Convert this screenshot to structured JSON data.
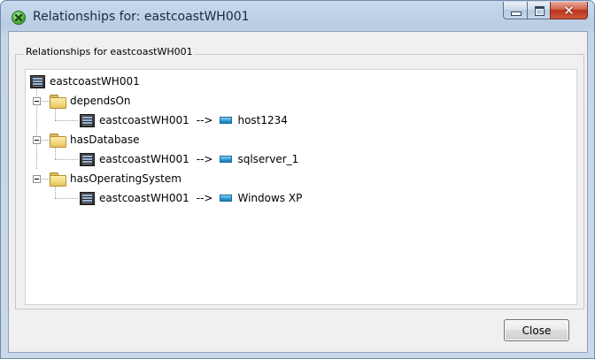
{
  "window": {
    "title": "Relationships for:  eastcoastWH001"
  },
  "group": {
    "legend": "Relationships for eastcoastWH001"
  },
  "tree": {
    "root": {
      "label": "eastcoastWH001",
      "icon": "server-icon"
    },
    "relations": [
      {
        "name": "dependsOn",
        "icon": "folder-icon",
        "child": {
          "source": "eastcoastWH001",
          "arrow": "-->",
          "target": "host1234",
          "target_icon": "host-icon"
        }
      },
      {
        "name": "hasDatabase",
        "icon": "folder-icon",
        "child": {
          "source": "eastcoastWH001",
          "arrow": "-->",
          "target": "sqlserver_1",
          "target_icon": "database-icon"
        }
      },
      {
        "name": "hasOperatingSystem",
        "icon": "folder-icon",
        "child": {
          "source": "eastcoastWH001",
          "arrow": "-->",
          "target": "Windows XP",
          "target_icon": "os-icon"
        }
      }
    ]
  },
  "buttons": {
    "close_label": "Close"
  },
  "colors": {
    "title_bar": "#c7d9ec",
    "client_bg": "#f0f0f0",
    "close_caption_button": "#d0644e"
  }
}
